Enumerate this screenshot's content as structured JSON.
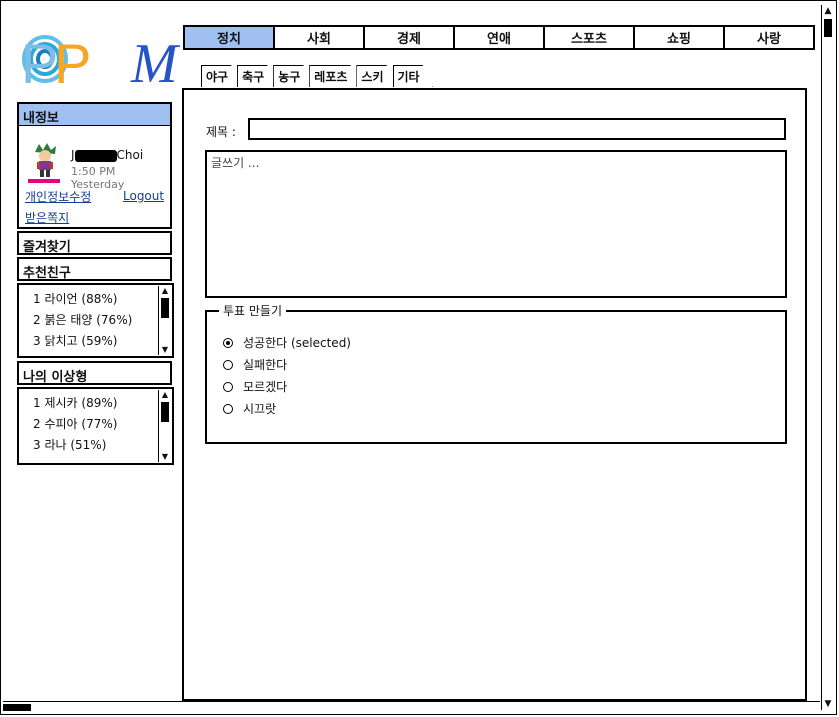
{
  "logo": {
    "letters": [
      "P",
      "P",
      "O",
      "M"
    ],
    "colors": [
      "#7fbde8",
      "#f5a623",
      "#2aa8d8",
      "#2553c8"
    ]
  },
  "profile": {
    "header": "내정보",
    "name_prefix": "J",
    "name_suffix": "Choi",
    "time": "1:50 PM Yesterday",
    "edit_link": "개인정보수정",
    "logout_link": "Logout",
    "messages_link": "받은쪽지"
  },
  "favorites": {
    "header": "즐겨찾기"
  },
  "recommended": {
    "header": "추천친구",
    "items": [
      "1 라이언 (88%)",
      "2 붉은 태양 (76%)",
      "3 닭치고 (59%)"
    ]
  },
  "ideal": {
    "header": "나의 이상형",
    "items": [
      "1 제시카 (89%)",
      "2 수피아 (77%)",
      "3 라나 (51%)"
    ]
  },
  "topnav": {
    "tabs": [
      "정치",
      "사회",
      "경제",
      "연애",
      "스포츠",
      "쇼핑",
      "사랑"
    ],
    "active": "정치"
  },
  "subtabs": [
    "야구",
    "축구",
    "농구",
    "레포츠",
    "스키",
    "기타"
  ],
  "form": {
    "title_label": "제목 :",
    "title_value": "",
    "content_placeholder": "글쓰기 ...",
    "poll_legend": "투표 만들기",
    "poll_options": [
      {
        "label": "성공한다 (selected)",
        "selected": true
      },
      {
        "label": "실패한다",
        "selected": false
      },
      {
        "label": "모르겠다",
        "selected": false
      },
      {
        "label": "시끄랏",
        "selected": false
      }
    ]
  },
  "colors": {
    "accent": "#9fc0f0",
    "link": "#133f8f",
    "avatar_bar": "#e8007c"
  }
}
